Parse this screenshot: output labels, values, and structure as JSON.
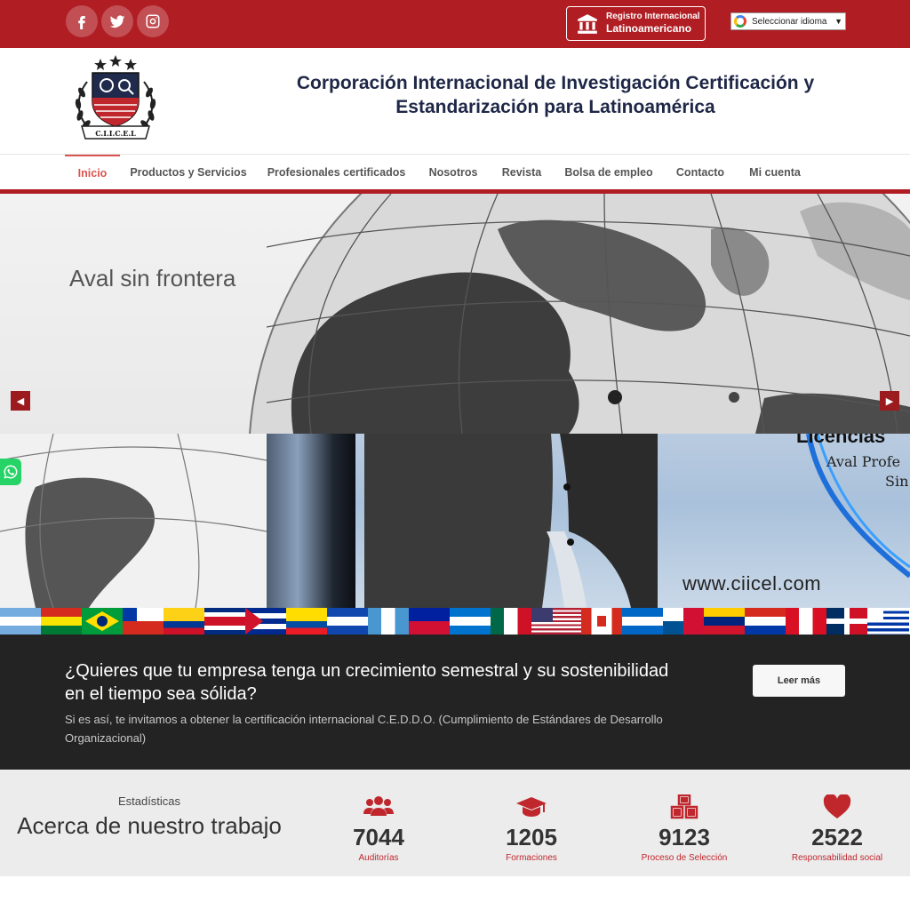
{
  "topbar": {
    "social": [
      "facebook-icon",
      "twitter-icon",
      "instagram-icon"
    ],
    "registro_line1": "Registro Internacional",
    "registro_line2": "Latinoamericano",
    "language_select": "Seleccionar idioma",
    "language_arrow": "▼"
  },
  "header": {
    "logo_text": "C.I.I.C.E.L",
    "title_line1": "Corporación Internacional de Investigación Certificación y",
    "title_line2": "Estandarización para Latinoamérica"
  },
  "nav": {
    "items": [
      "Inicio",
      "Productos y Servicios",
      "Profesionales certificados",
      "Nosotros",
      "Revista",
      "Bolsa de empleo",
      "Contacto",
      "Mi cuenta"
    ],
    "active": "Inicio"
  },
  "slider": {
    "caption": "Aval sin frontera",
    "prev_icon": "caret-left-icon",
    "next_icon": "caret-right-icon"
  },
  "banner": {
    "heading1": "Licencias",
    "heading2": "Aval Profe",
    "heading3": "Sin",
    "url": "www.ciicel.com"
  },
  "promo": {
    "title": "¿Quieres que tu empresa tenga un crecimiento semestral y su sostenibilidad en el tiempo sea sólida?",
    "text": "Si es así, te invitamos a obtener la certificación internacional C.E.D.D.O. (Cumplimiento de Estándares de Desarrollo Organizacional)",
    "button": "Leer más"
  },
  "stats": {
    "kicker": "Estadísticas",
    "heading": "Acerca de nuestro trabajo",
    "items": [
      {
        "icon": "users-icon",
        "value": "7044",
        "label": "Auditorías"
      },
      {
        "icon": "graduation-cap-icon",
        "value": "1205",
        "label": "Formaciones"
      },
      {
        "icon": "cubes-icon",
        "value": "9123",
        "label": "Proceso de Selección"
      },
      {
        "icon": "heart-icon",
        "value": "2522",
        "label": "Responsabilidad social"
      }
    ]
  },
  "colors": {
    "brand_red": "#b01e24",
    "nav_active": "#d9534f",
    "dark_band": "#232323",
    "stats_bg": "#ececec",
    "stat_accent": "#c0272d"
  }
}
